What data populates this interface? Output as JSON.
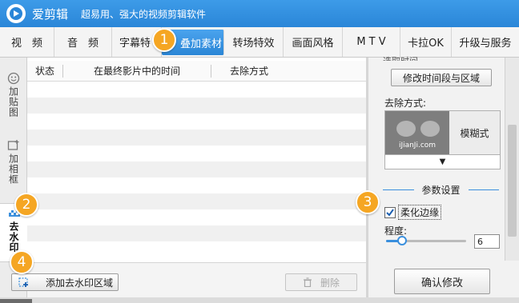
{
  "app": {
    "name": "爱剪辑",
    "slogan": "超易用、强大的视频剪辑软件",
    "accent_color": "#2a86d8"
  },
  "tabs": [
    {
      "label": "视　频"
    },
    {
      "label": "音　频"
    },
    {
      "label": "字幕特"
    },
    {
      "label": "叠加素材",
      "active": true
    },
    {
      "label": "转场特效"
    },
    {
      "label": "画面风格"
    },
    {
      "label": "M T V"
    },
    {
      "label": "卡拉OK"
    },
    {
      "label": "升级与服务"
    }
  ],
  "side_tabs": [
    {
      "label": "加贴图",
      "icon": "smiley-icon"
    },
    {
      "label": "加相框",
      "icon": "frame-plus-icon"
    },
    {
      "label": "去水印",
      "icon": "mosaic-icon",
      "active": true
    }
  ],
  "table": {
    "columns": [
      "状态",
      "在最终影片中的时间",
      "去除方式"
    ],
    "rows": []
  },
  "left_bottom": {
    "add_button": "添加去水印区域",
    "delete_button": "删除"
  },
  "right_panel": {
    "cut_label": "选取时间",
    "edit_time_button": "修改时间段与区域",
    "removal_label": "去除方式:",
    "preview_watermark": "iJianJi.com",
    "removal_mode": "模糊式",
    "dropdown_arrow": "▼",
    "params_title": "参数设置",
    "soften_edges_label": "柔化边缘",
    "soften_edges_checked": true,
    "degree_label": "程度:",
    "degree_value": "6",
    "degree_fraction": 0.2,
    "confirm_button": "确认修改"
  },
  "badges": [
    "1",
    "2",
    "3",
    "4"
  ]
}
